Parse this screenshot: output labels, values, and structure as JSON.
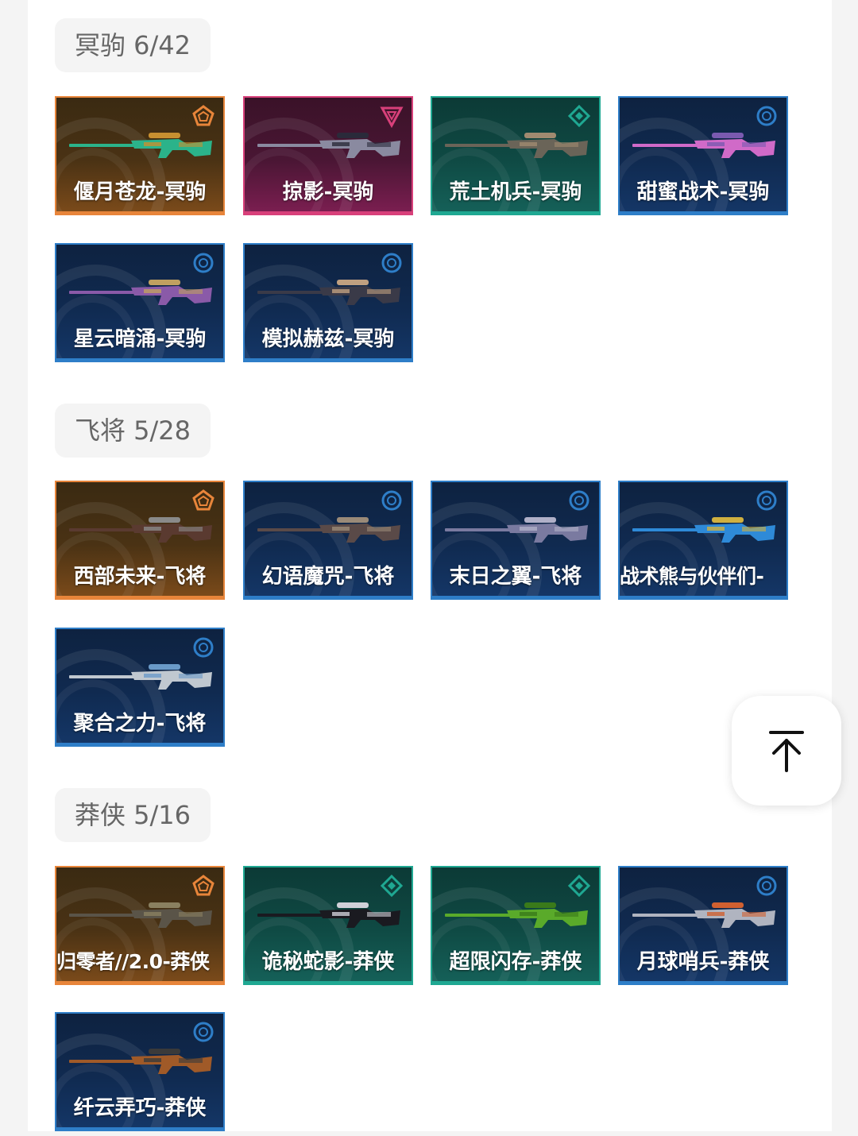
{
  "sections": [
    {
      "tag": "冥驹 6/42",
      "items": [
        {
          "name": "偃月苍龙-冥驹",
          "tier": "orange",
          "tier_icon": "pentagon-rank-icon",
          "gun_colors": [
            "#2bb38a",
            "#c89030"
          ]
        },
        {
          "name": "掠影-冥驹",
          "tier": "pink",
          "tier_icon": "triangle-rank-icon",
          "gun_colors": [
            "#8a8aa0",
            "#2a2a3a"
          ]
        },
        {
          "name": "荒土机兵-冥驹",
          "tier": "teal",
          "tier_icon": "diamond-rank-icon",
          "gun_colors": [
            "#6a6458",
            "#a08a70"
          ]
        },
        {
          "name": "甜蜜战术-冥驹",
          "tier": "blue",
          "tier_icon": "circle-rank-icon",
          "gun_colors": [
            "#d06ac8",
            "#7a5ab0"
          ]
        },
        {
          "name": "星云暗涌-冥驹",
          "tier": "blue",
          "tier_icon": "circle-rank-icon",
          "gun_colors": [
            "#8a5aa8",
            "#c0a060"
          ]
        },
        {
          "name": "模拟赫兹-冥驹",
          "tier": "blue",
          "tier_icon": "circle-rank-icon",
          "gun_colors": [
            "#3a3a48",
            "#c0a080"
          ]
        }
      ]
    },
    {
      "tag": "飞将 5/28",
      "items": [
        {
          "name": "西部未来-飞将",
          "tier": "orange",
          "tier_icon": "pentagon-rank-icon",
          "gun_colors": [
            "#5a3a30",
            "#8a8a8a"
          ]
        },
        {
          "name": "幻语魔咒-飞将",
          "tier": "blue",
          "tier_icon": "circle-rank-icon",
          "gun_colors": [
            "#5a4a48",
            "#9a8a78"
          ]
        },
        {
          "name": "末日之翼-飞将",
          "tier": "blue",
          "tier_icon": "circle-rank-icon",
          "gun_colors": [
            "#7a7aa0",
            "#b0b0c8"
          ]
        },
        {
          "name": "战术熊与伙伴们-",
          "tier": "blue",
          "tier_icon": "circle-rank-icon",
          "gun_colors": [
            "#2e8ad8",
            "#d0b040"
          ]
        },
        {
          "name": "聚合之力-飞将",
          "tier": "blue",
          "tier_icon": "circle-rank-icon",
          "gun_colors": [
            "#c0c8d0",
            "#6a9ac8"
          ]
        }
      ]
    },
    {
      "tag": "莽侠 5/16",
      "items": [
        {
          "name": "归零者//2.0-莽侠",
          "tier": "orange",
          "tier_icon": "pentagon-rank-icon",
          "gun_colors": [
            "#5a5448",
            "#8a8060"
          ]
        },
        {
          "name": "诡秘蛇影-莽侠",
          "tier": "teal",
          "tier_icon": "diamond-rank-icon",
          "gun_colors": [
            "#1a1a20",
            "#d0d0d8"
          ]
        },
        {
          "name": "超限闪存-莽侠",
          "tier": "teal",
          "tier_icon": "diamond-rank-icon",
          "gun_colors": [
            "#5aaa2a",
            "#3a7a1a"
          ]
        },
        {
          "name": "月球哨兵-莽侠",
          "tier": "blue",
          "tier_icon": "circle-rank-icon",
          "gun_colors": [
            "#b0b4c0",
            "#d06030"
          ]
        },
        {
          "name": "纤云弄巧-莽侠",
          "tier": "blue",
          "tier_icon": "circle-rank-icon",
          "gun_colors": [
            "#a05a28",
            "#3a3a3a"
          ]
        }
      ]
    }
  ],
  "back_to_top_icon": "arrow-up-to-top-icon",
  "tier_colors": {
    "orange": "#e8853a",
    "pink": "#d8407a",
    "teal": "#1fa892",
    "blue": "#2e7ec8"
  }
}
